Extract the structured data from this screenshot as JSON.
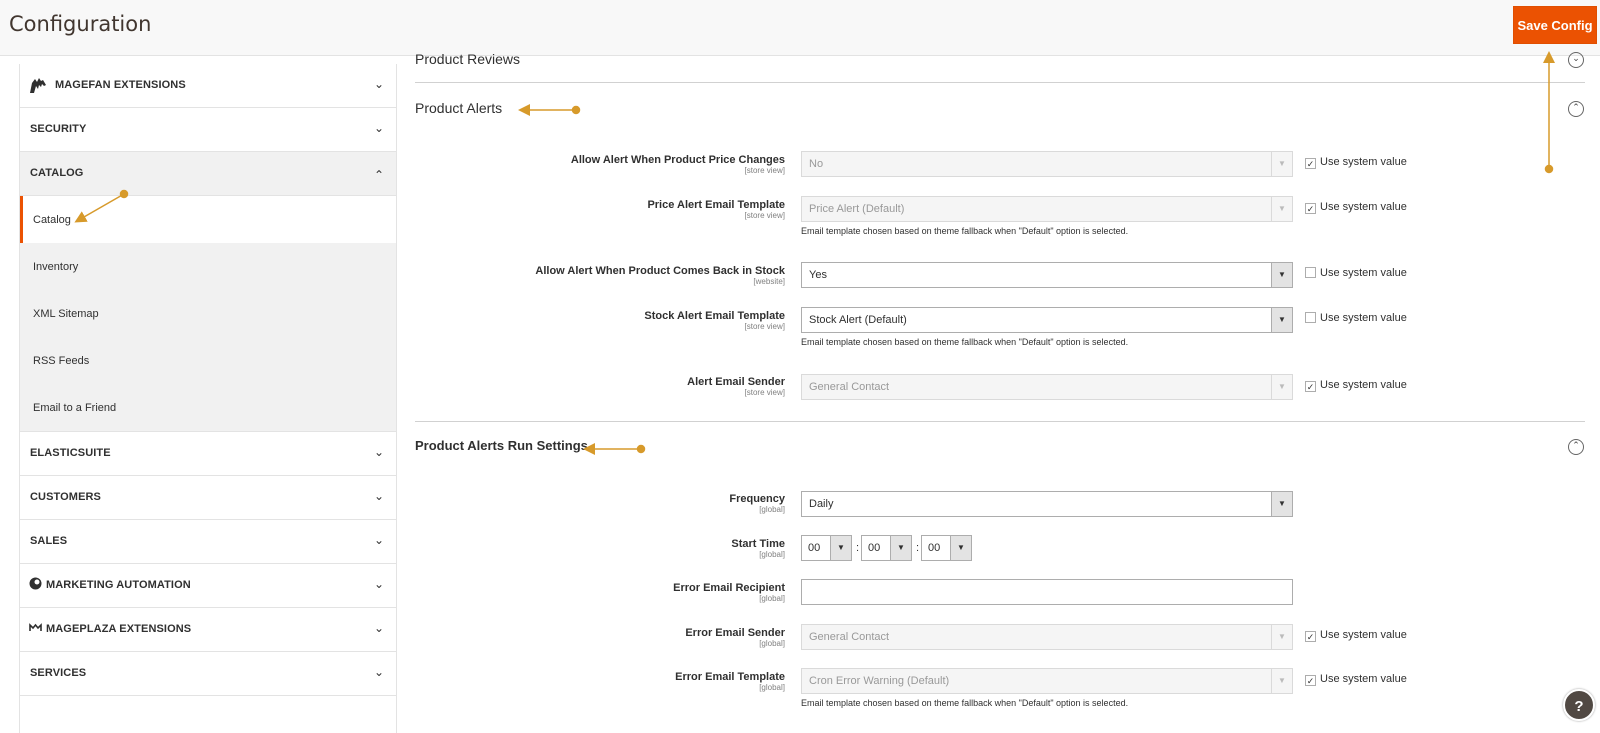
{
  "header": {
    "title": "Configuration",
    "save_label": "Save Config"
  },
  "sidebar": {
    "groups_top": [
      {
        "label": "MAGEFAN EXTENSIONS",
        "icon": "magefan-icon"
      },
      {
        "label": "SECURITY"
      }
    ],
    "catalog": {
      "label": "CATALOG",
      "items": [
        "Catalog",
        "Inventory",
        "XML Sitemap",
        "RSS Feeds",
        "Email to a Friend"
      ]
    },
    "groups_bottom": [
      {
        "label": "ELASTICSUITE"
      },
      {
        "label": "CUSTOMERS"
      },
      {
        "label": "SALES"
      },
      {
        "label": "MARKETING AUTOMATION",
        "icon": "marketing-icon"
      },
      {
        "label": "MAGEPLAZA EXTENSIONS",
        "icon": "mageplaza-icon"
      },
      {
        "label": "SERVICES"
      }
    ]
  },
  "sections": {
    "reviews": {
      "title": "Product Reviews"
    },
    "alerts": {
      "title": "Product Alerts"
    },
    "run": {
      "title": "Product Alerts Run Settings"
    }
  },
  "fields": {
    "price_change": {
      "label": "Allow Alert When Product Price Changes",
      "scope": "[store view]",
      "value": "No",
      "system": true
    },
    "price_template": {
      "label": "Price Alert Email Template",
      "scope": "[store view]",
      "value": "Price Alert (Default)",
      "system": true,
      "note": "Email template chosen based on theme fallback when \"Default\" option is selected."
    },
    "back_in_stock": {
      "label": "Allow Alert When Product Comes Back in Stock",
      "scope": "[website]",
      "value": "Yes",
      "system": false
    },
    "stock_template": {
      "label": "Stock Alert Email Template",
      "scope": "[store view]",
      "value": "Stock Alert (Default)",
      "system": false,
      "note": "Email template chosen based on theme fallback when \"Default\" option is selected."
    },
    "alert_sender": {
      "label": "Alert Email Sender",
      "scope": "[store view]",
      "value": "General Contact",
      "system": true
    },
    "frequency": {
      "label": "Frequency",
      "scope": "[global]",
      "value": "Daily"
    },
    "start_time": {
      "label": "Start Time",
      "scope": "[global]",
      "hour": "00",
      "minute": "00",
      "second": "00",
      "sep": ":"
    },
    "error_recipient": {
      "label": "Error Email Recipient",
      "scope": "[global]",
      "value": ""
    },
    "error_sender": {
      "label": "Error Email Sender",
      "scope": "[global]",
      "value": "General Contact",
      "system": true
    },
    "error_template": {
      "label": "Error Email Template",
      "scope": "[global]",
      "value": "Cron Error Warning (Default)",
      "system": true,
      "note": "Email template chosen based on theme fallback when \"Default\" option is selected."
    }
  },
  "system_value_label": "Use system value",
  "help_label": "?",
  "colors": {
    "accent": "#eb5202",
    "annotation": "#d79a2b"
  }
}
